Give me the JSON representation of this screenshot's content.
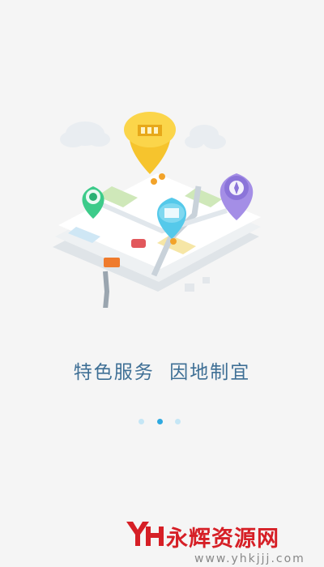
{
  "onboarding": {
    "tagline": "特色服务  因地制宜",
    "page_indicator": {
      "total": 3,
      "active": 2
    },
    "illustration_icons": [
      "building-icon",
      "compass-icon",
      "globe-icon",
      "package-icon"
    ]
  },
  "watermark": {
    "title": "永辉资源网",
    "url": "www.yhkjjj.com",
    "logo_text": "YH"
  },
  "colors": {
    "background": "#f5f5f5",
    "tagline": "#3e6f95",
    "dot_active": "#2ea9e0",
    "dot_inactive": "#c5e6f5",
    "watermark_red": "#d61f26",
    "pin_yellow": "#f6c42d",
    "pin_purple": "#a48ee6",
    "pin_cyan": "#55c9ea",
    "pin_green": "#3dcb8a"
  }
}
